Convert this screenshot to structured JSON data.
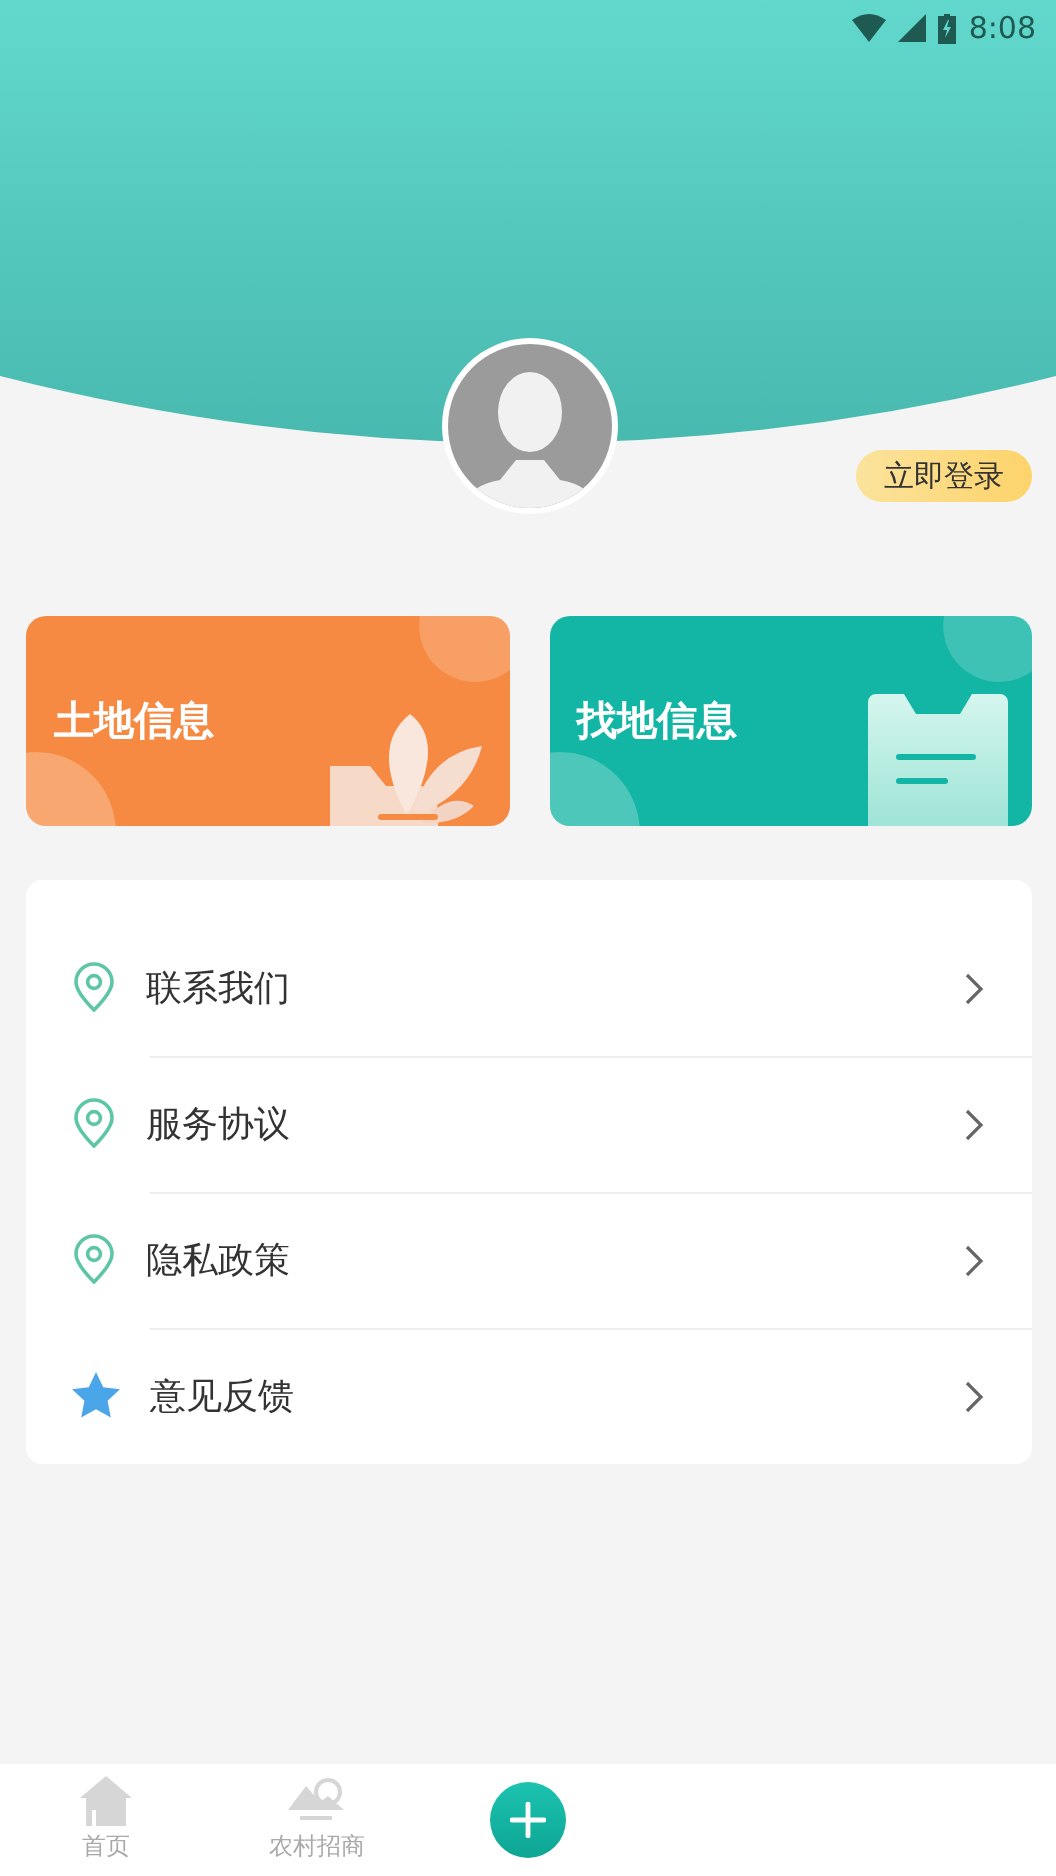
{
  "status_bar": {
    "time": "8:08"
  },
  "login_button": {
    "label": "立即登录"
  },
  "cards": [
    {
      "title": "土地信息",
      "kind": "land",
      "color": "#f68a42"
    },
    {
      "title": "找地信息",
      "kind": "find",
      "color": "#13b5a5"
    }
  ],
  "menu": [
    {
      "label": "联系我们",
      "kind": "pin"
    },
    {
      "label": "服务协议",
      "kind": "pin"
    },
    {
      "label": "隐私政策",
      "kind": "pin"
    },
    {
      "label": "意见反馈",
      "kind": "star"
    }
  ],
  "tab_bar": [
    {
      "label": "首页",
      "kind": "home",
      "selected": false
    },
    {
      "label": "农村招商",
      "kind": "mountain",
      "selected": false
    },
    {
      "kind": "add"
    }
  ]
}
